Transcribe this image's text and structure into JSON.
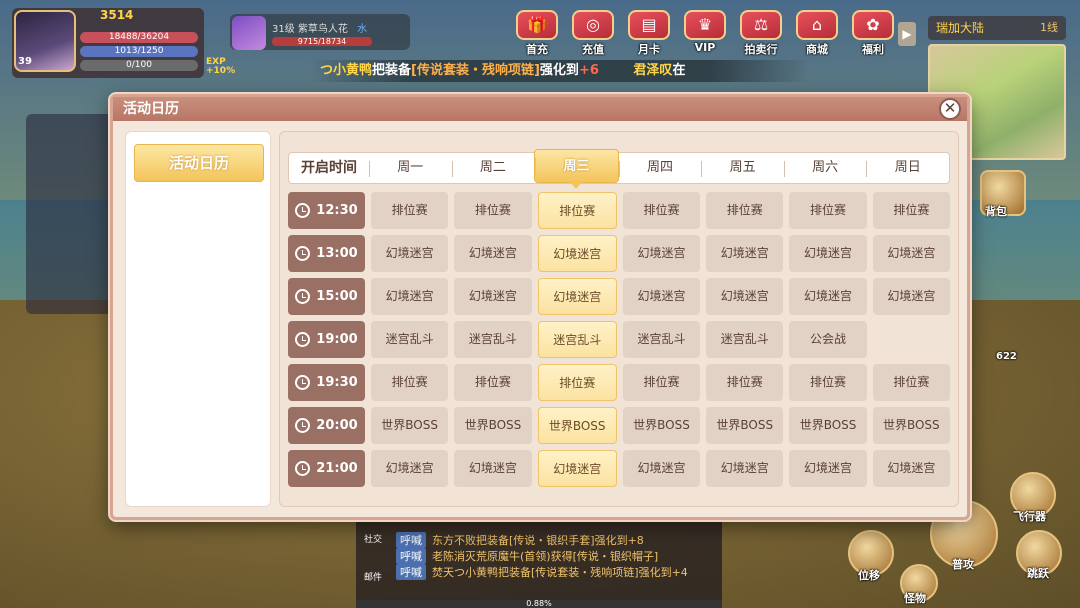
{
  "hud": {
    "player": {
      "level": "39",
      "power": "3514",
      "hp": "18488/36204",
      "mp": "1013/1250",
      "xp": "0/100",
      "exp_tag": "EXP +10%"
    },
    "target": {
      "info": "31级 紫草鸟人花",
      "element": "水",
      "hp": "9715/18734"
    },
    "announcement": {
      "name1": "つ小黄鸭",
      "mid": "把装备",
      "item": "[传说套装・残响项链]",
      "mid2": "强化到",
      "lvl": "+6",
      "name2": "君泽叹",
      "tail": "在"
    },
    "top_menu": [
      {
        "label": "首充",
        "icon": "gift-icon"
      },
      {
        "label": "充值",
        "icon": "coin-icon"
      },
      {
        "label": "月卡",
        "icon": "card-icon"
      },
      {
        "label": "VIP",
        "icon": "crown-icon"
      },
      {
        "label": "拍卖行",
        "icon": "scale-icon"
      },
      {
        "label": "商城",
        "icon": "shop-icon"
      },
      {
        "label": "福利",
        "icon": "bag-icon"
      }
    ],
    "menu_arrow": "▶",
    "region": "瑞加大陆",
    "region_line": "1线",
    "side": {
      "bag": "背包",
      "fly": "飞行器",
      "dodge": "位移",
      "attack": "普攻",
      "jump": "跳跃",
      "monster": "怪物",
      "count": "622"
    }
  },
  "chat": {
    "social": "社交",
    "mail": "邮件",
    "rows": [
      {
        "tag": "呼喊",
        "text": "东方不败把装备[传说・银织手套]强化到+8"
      },
      {
        "tag": "呼喊",
        "text": "老陈消灭荒原魔牛(首领)获得[传说・银织帽子]"
      },
      {
        "tag": "呼喊",
        "text": "焚天つ小黄鸭把装备[传说套装・残响项链]强化到+4"
      }
    ],
    "xp_footer": "0.88%"
  },
  "modal": {
    "title": "活动日历",
    "close": "✕",
    "left_tab": "活动日历",
    "header": {
      "time": "开启时间",
      "days": [
        "周一",
        "周二",
        "周三",
        "周四",
        "周五",
        "周六",
        "周日"
      ],
      "active_index": 2
    },
    "rows": [
      {
        "time": "12:30",
        "events": [
          "排位赛",
          "排位赛",
          "排位赛",
          "排位赛",
          "排位赛",
          "排位赛",
          "排位赛"
        ]
      },
      {
        "time": "13:00",
        "events": [
          "幻境迷宫",
          "幻境迷宫",
          "幻境迷宫",
          "幻境迷宫",
          "幻境迷宫",
          "幻境迷宫",
          "幻境迷宫"
        ]
      },
      {
        "time": "15:00",
        "events": [
          "幻境迷宫",
          "幻境迷宫",
          "幻境迷宫",
          "幻境迷宫",
          "幻境迷宫",
          "幻境迷宫",
          "幻境迷宫"
        ]
      },
      {
        "time": "19:00",
        "events": [
          "迷宫乱斗",
          "迷宫乱斗",
          "迷宫乱斗",
          "迷宫乱斗",
          "迷宫乱斗",
          "公会战",
          ""
        ]
      },
      {
        "time": "19:30",
        "events": [
          "排位赛",
          "排位赛",
          "排位赛",
          "排位赛",
          "排位赛",
          "排位赛",
          "排位赛"
        ]
      },
      {
        "time": "20:00",
        "events": [
          "世界BOSS",
          "世界BOSS",
          "世界BOSS",
          "世界BOSS",
          "世界BOSS",
          "世界BOSS",
          "世界BOSS"
        ]
      },
      {
        "time": "21:00",
        "events": [
          "幻境迷宫",
          "幻境迷宫",
          "幻境迷宫",
          "幻境迷宫",
          "幻境迷宫",
          "幻境迷宫",
          "幻境迷宫"
        ]
      }
    ]
  }
}
